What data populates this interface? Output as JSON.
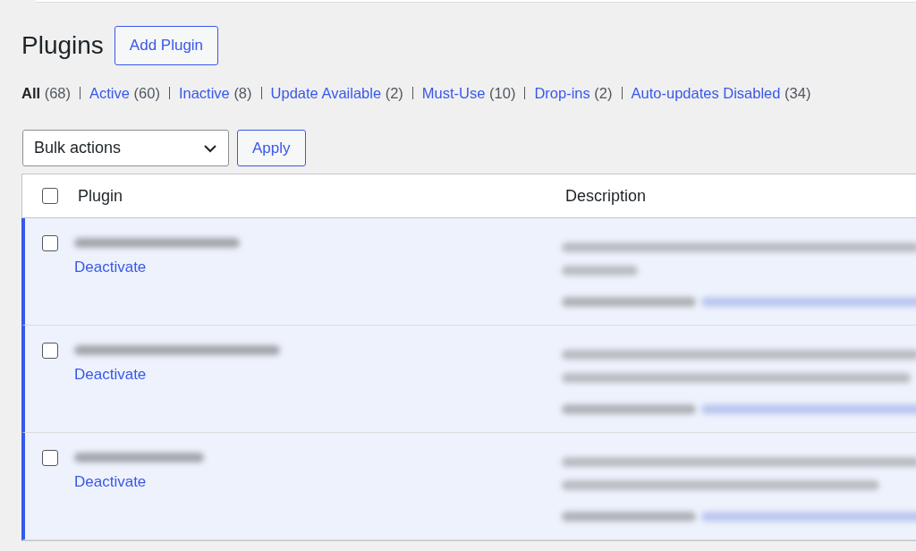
{
  "page": {
    "title": "Plugins",
    "add_button": "Add Plugin"
  },
  "filters": [
    {
      "label": "All",
      "count": "(68)",
      "selected": true
    },
    {
      "label": "Active",
      "count": "(60)",
      "selected": false
    },
    {
      "label": "Inactive",
      "count": "(8)",
      "selected": false
    },
    {
      "label": "Update Available",
      "count": "(2)",
      "selected": false
    },
    {
      "label": "Must-Use",
      "count": "(10)",
      "selected": false
    },
    {
      "label": "Drop-ins",
      "count": "(2)",
      "selected": false
    },
    {
      "label": "Auto-updates Disabled",
      "count": "(34)",
      "selected": false
    }
  ],
  "bulk": {
    "value": "Bulk actions",
    "apply": "Apply"
  },
  "table": {
    "columns": [
      "Plugin",
      "Description"
    ],
    "select_all_checked": false,
    "rows": [
      {
        "active": true,
        "checked": false,
        "action": "Deactivate"
      },
      {
        "active": true,
        "checked": false,
        "action": "Deactivate"
      },
      {
        "active": true,
        "checked": false,
        "action": "Deactivate"
      }
    ]
  }
}
